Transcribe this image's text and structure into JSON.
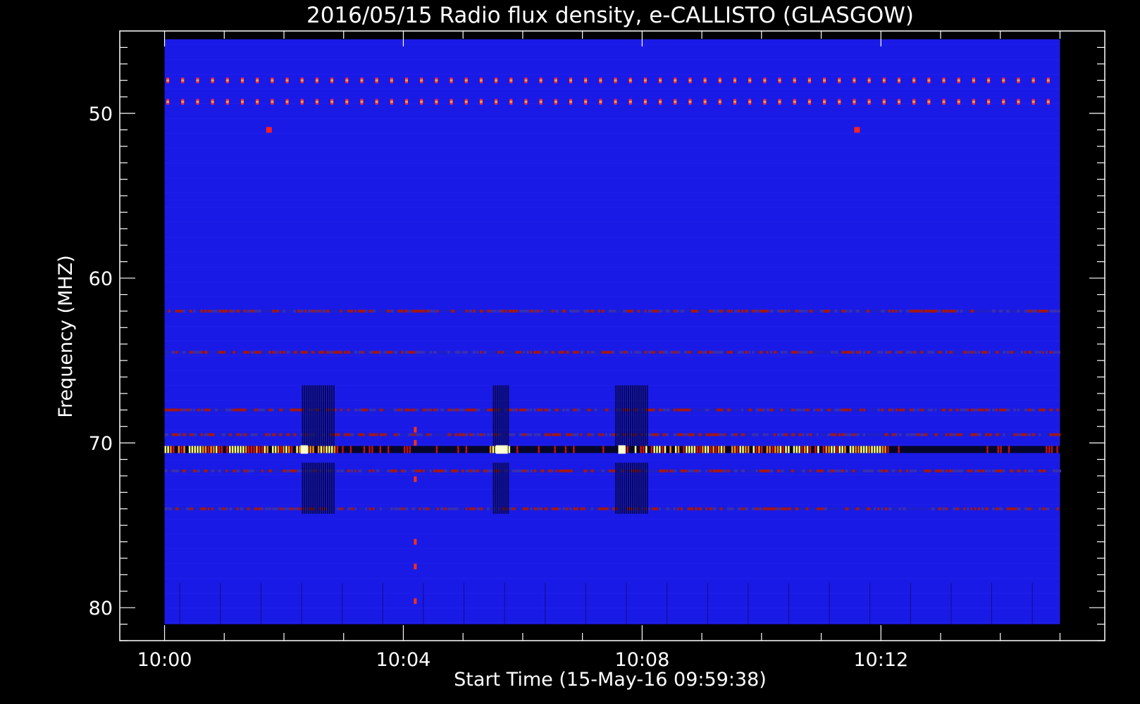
{
  "chart_data": {
    "type": "heatmap",
    "title": "2016/05/15  Radio flux density, e-CALLISTO (GLASGOW)",
    "xlabel": "Start Time (15-May-16 09:59:38)",
    "ylabel": "Frequency (MHZ)",
    "x_ticks": [
      "10:00",
      "10:04",
      "10:08",
      "10:12"
    ],
    "x_tick_minutes": [
      0,
      4,
      8,
      12
    ],
    "y_ticks": [
      50,
      60,
      70,
      80
    ],
    "xlim_minutes": [
      -0.75,
      15.75
    ],
    "data_x_minutes": [
      0,
      15
    ],
    "ylim": [
      45,
      82
    ],
    "data_y": [
      45.5,
      81
    ],
    "y_inverted": true,
    "background_color": "#1a1ae6",
    "colormap": [
      "#000000",
      "#1a1ae6",
      "#dd1010",
      "#ff8c00",
      "#ffff80"
    ],
    "features": {
      "periodic_lines_mhz": [
        48,
        49.3
      ],
      "periodic_spacing_min": 0.25,
      "dots": [
        {
          "x": 1.75,
          "y": 51
        },
        {
          "x": 11.6,
          "y": 51
        }
      ],
      "strong_band_mhz": 70.4,
      "band_mhz": [
        62,
        64.5,
        68,
        69.5,
        71.7,
        74
      ],
      "burst_intervals_min": [
        [
          2.3,
          2.85
        ],
        [
          5.5,
          5.75
        ],
        [
          7.55,
          8.1
        ]
      ],
      "spike_column_min": 4.2
    }
  }
}
